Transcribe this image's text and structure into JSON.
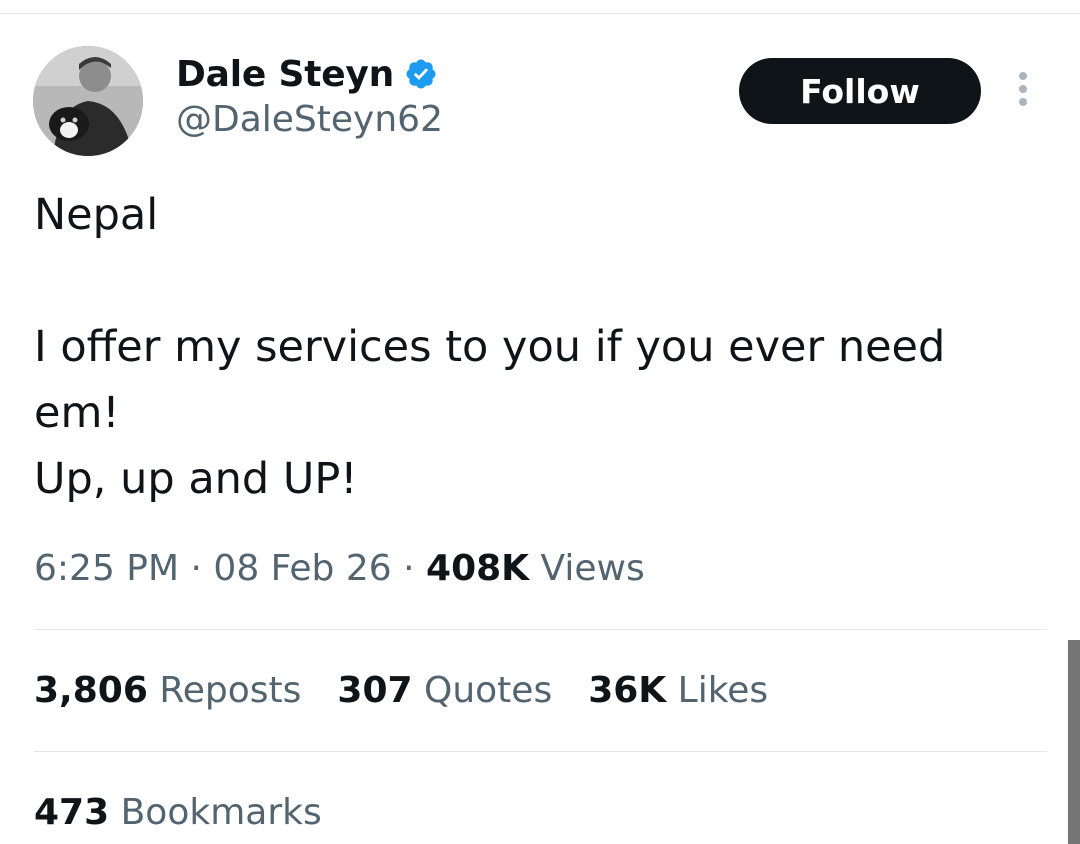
{
  "author": {
    "display_name": "Dale Steyn",
    "handle": "@DaleSteyn62",
    "verified_icon": "verified-badge-icon",
    "avatar_icon": "profile-photo"
  },
  "actions": {
    "follow_label": "Follow",
    "more_icon": "more-vertical-icon"
  },
  "tweet": {
    "text": "Nepal\n\nI offer my services to you if you ever need em!\nUp, up and UP!"
  },
  "meta": {
    "time": "6:25 PM",
    "separator": "·",
    "date": "08 Feb 26",
    "views_count": "408K",
    "views_label": "Views"
  },
  "engagement": {
    "reposts_count": "3,806",
    "reposts_label": "Reposts",
    "quotes_count": "307",
    "quotes_label": "Quotes",
    "likes_count": "36K",
    "likes_label": "Likes",
    "bookmarks_count": "473",
    "bookmarks_label": "Bookmarks"
  },
  "colors": {
    "text_primary": "#0f1419",
    "text_secondary": "#536471",
    "verified_blue": "#1d9bf0",
    "button_bg": "#0f1419",
    "divider": "#e3e6e9"
  }
}
